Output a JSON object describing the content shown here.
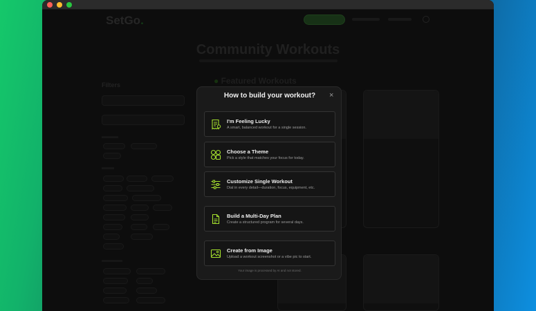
{
  "colors": {
    "accent": "#a6e22e",
    "modal_bg": "#1a1a1a"
  },
  "modal": {
    "title": "How to build your workout?",
    "close_icon": "×",
    "options": [
      {
        "icon": "receipt-icon",
        "title": "I'm Feeling Lucky",
        "description": "A smart, balanced workout for a single session."
      },
      {
        "icon": "grid-icon",
        "title": "Choose a Theme",
        "description": "Pick a style that matches your focus for today."
      },
      {
        "icon": "sliders-icon",
        "title": "Customize Single Workout",
        "description": "Dial in every detail—duration, focus, equipment, etc."
      },
      {
        "icon": "document-icon",
        "title": "Build a Multi-Day Plan",
        "description": "Create a structured program for several days."
      },
      {
        "icon": "image-icon",
        "title": "Create from Image",
        "description": "Upload a workout screenshot or a vibe pic to start."
      }
    ],
    "footer": "Your image is processed by AI and not stored."
  },
  "background": {
    "logo": "SetGo",
    "logo_dot": ".",
    "hero_title": "Community Workouts",
    "filters_title": "Filters",
    "featured_title": "Featured Workouts"
  }
}
